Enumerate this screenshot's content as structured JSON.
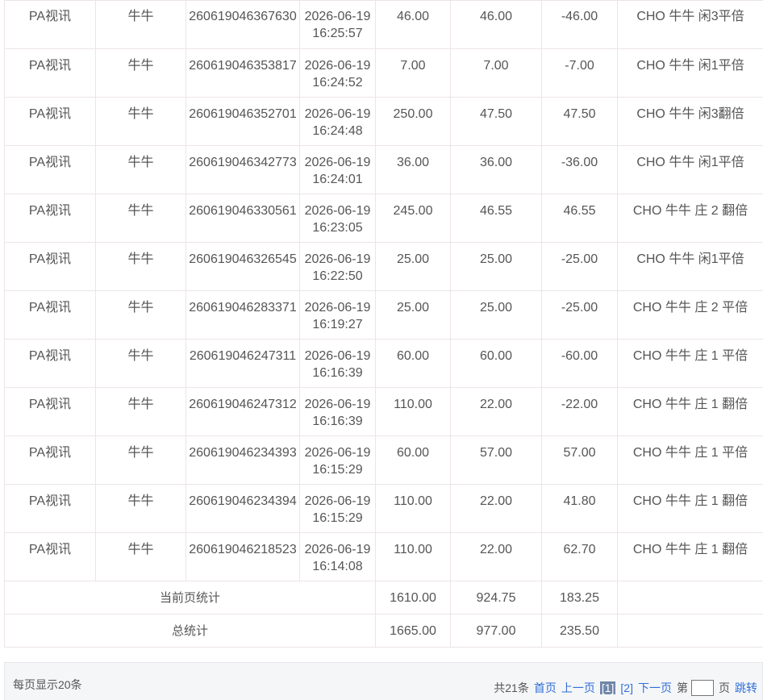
{
  "rows": [
    {
      "platform": "PA视讯",
      "game": "牛牛",
      "order": "260619046367630",
      "time": "2026-06-19 16:25:57",
      "bet": "46.00",
      "valid": "46.00",
      "win": "-46.00",
      "detail": "CHO 牛牛 闲3平倍"
    },
    {
      "platform": "PA视讯",
      "game": "牛牛",
      "order": "260619046353817",
      "time": "2026-06-19 16:24:52",
      "bet": "7.00",
      "valid": "7.00",
      "win": "-7.00",
      "detail": "CHO 牛牛 闲1平倍"
    },
    {
      "platform": "PA视讯",
      "game": "牛牛",
      "order": "260619046352701",
      "time": "2026-06-19 16:24:48",
      "bet": "250.00",
      "valid": "47.50",
      "win": "47.50",
      "detail": "CHO 牛牛 闲3翻倍"
    },
    {
      "platform": "PA视讯",
      "game": "牛牛",
      "order": "260619046342773",
      "time": "2026-06-19 16:24:01",
      "bet": "36.00",
      "valid": "36.00",
      "win": "-36.00",
      "detail": "CHO 牛牛 闲1平倍"
    },
    {
      "platform": "PA视讯",
      "game": "牛牛",
      "order": "260619046330561",
      "time": "2026-06-19 16:23:05",
      "bet": "245.00",
      "valid": "46.55",
      "win": "46.55",
      "detail": "CHO 牛牛 庄 2 翻倍"
    },
    {
      "platform": "PA视讯",
      "game": "牛牛",
      "order": "260619046326545",
      "time": "2026-06-19 16:22:50",
      "bet": "25.00",
      "valid": "25.00",
      "win": "-25.00",
      "detail": "CHO 牛牛 闲1平倍"
    },
    {
      "platform": "PA视讯",
      "game": "牛牛",
      "order": "260619046283371",
      "time": "2026-06-19 16:19:27",
      "bet": "25.00",
      "valid": "25.00",
      "win": "-25.00",
      "detail": "CHO 牛牛 庄 2 平倍"
    },
    {
      "platform": "PA视讯",
      "game": "牛牛",
      "order": "260619046247311",
      "time": "2026-06-19 16:16:39",
      "bet": "60.00",
      "valid": "60.00",
      "win": "-60.00",
      "detail": "CHO 牛牛 庄 1 平倍"
    },
    {
      "platform": "PA视讯",
      "game": "牛牛",
      "order": "260619046247312",
      "time": "2026-06-19 16:16:39",
      "bet": "110.00",
      "valid": "22.00",
      "win": "-22.00",
      "detail": "CHO 牛牛 庄 1 翻倍"
    },
    {
      "platform": "PA视讯",
      "game": "牛牛",
      "order": "260619046234393",
      "time": "2026-06-19 16:15:29",
      "bet": "60.00",
      "valid": "57.00",
      "win": "57.00",
      "detail": "CHO 牛牛 庄 1 平倍"
    },
    {
      "platform": "PA视讯",
      "game": "牛牛",
      "order": "260619046234394",
      "time": "2026-06-19 16:15:29",
      "bet": "110.00",
      "valid": "22.00",
      "win": "41.80",
      "detail": "CHO 牛牛 庄 1 翻倍"
    },
    {
      "platform": "PA视讯",
      "game": "牛牛",
      "order": "260619046218523",
      "time": "2026-06-19 16:14:08",
      "bet": "110.00",
      "valid": "22.00",
      "win": "62.70",
      "detail": "CHO 牛牛 庄 1 翻倍"
    }
  ],
  "summary": {
    "page": {
      "label": "当前页统计",
      "bet": "1610.00",
      "valid": "924.75",
      "win": "183.25"
    },
    "total": {
      "label": "总统计",
      "bet": "1665.00",
      "valid": "977.00",
      "win": "235.50"
    }
  },
  "pager": {
    "per_page": "每页显示20条",
    "total": "共21条",
    "first": "首页",
    "prev": "上一页",
    "current": "[1]",
    "page2": "[2]",
    "next": "下一页",
    "go_prefix": "第",
    "go_suffix": "页",
    "jump": "跳转",
    "page_input_value": ""
  }
}
